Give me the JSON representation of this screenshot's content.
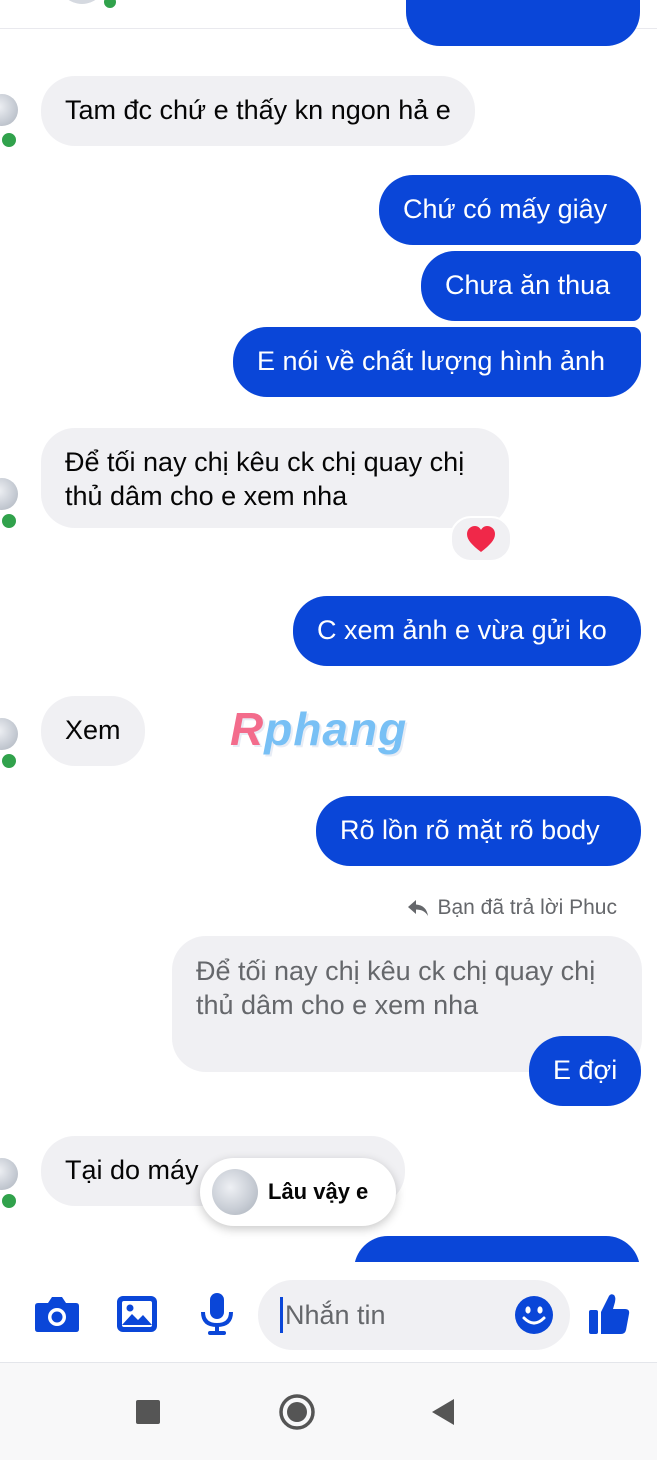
{
  "colors": {
    "outgoing": "#0a46d8",
    "incoming": "#f0f0f3",
    "online": "#31a24c"
  },
  "messages": [
    {
      "dir": "in",
      "text": "Tam đc chứ e thấy kn ngon hả e"
    },
    {
      "dir": "out",
      "text": "Chứ có mấy giây"
    },
    {
      "dir": "out",
      "text": "Chưa ăn thua"
    },
    {
      "dir": "out",
      "text": "E nói về chất lượng hình ảnh"
    },
    {
      "dir": "in",
      "lines": [
        "Để tối nay chị kêu ck chị quay chị",
        "thủ dâm cho e xem nha"
      ],
      "reaction": "heart"
    },
    {
      "dir": "out",
      "text": "C xem ảnh e vừa gửi ko"
    },
    {
      "dir": "in",
      "text": "Xem"
    },
    {
      "dir": "out",
      "text": "Rõ lồn rõ mặt rõ body"
    },
    {
      "dir": "out",
      "text": "E đợi"
    },
    {
      "dir": "in",
      "text": "Tại do máy"
    }
  ],
  "watermark": {
    "part1": "R",
    "part2": "phang"
  },
  "reply": {
    "note": "Bạn đã trả lời Phuc",
    "quote_lines": [
      "Để tối nay chị kêu ck chị quay chị",
      "thủ dâm cho e xem nha"
    ]
  },
  "floating_preview": {
    "text": "Lâu vậy e"
  },
  "composer": {
    "placeholder": "Nhắn tin",
    "icons": [
      "camera-icon",
      "image-icon",
      "microphone-icon",
      "emoji-icon",
      "like-icon"
    ]
  },
  "navbar": {
    "icons": [
      "recents-square-icon",
      "home-circle-icon",
      "back-triangle-icon"
    ]
  }
}
